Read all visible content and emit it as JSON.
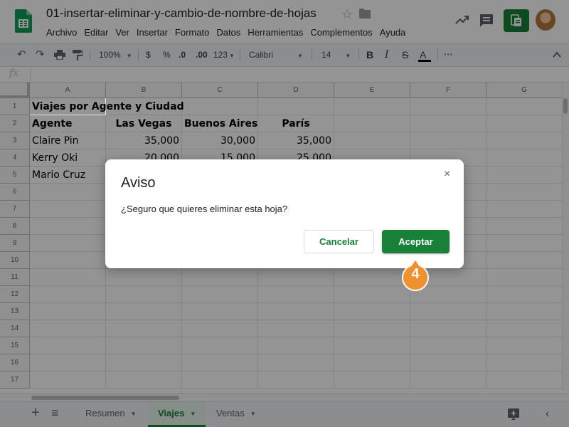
{
  "window": {
    "doc_title": "01-insertar-eliminar-y-cambio-de-nombre-de-hojas"
  },
  "menu": [
    "Archivo",
    "Editar",
    "Ver",
    "Insertar",
    "Formato",
    "Datos",
    "Herramientas",
    "Complementos",
    "Ayuda"
  ],
  "toolbar": {
    "zoom": "100%",
    "currency": "$",
    "percent": "%",
    "decrease_decimals": ".0",
    "increase_decimals": ".00",
    "more_formats": "123",
    "font": "Calibri",
    "font_size": "14",
    "bold": "B",
    "italic": "I",
    "strikethrough": "S",
    "text_color": "A",
    "more": "···"
  },
  "formula_bar": {
    "label": "fx",
    "value": ""
  },
  "grid": {
    "columns": [
      "A",
      "B",
      "C",
      "D",
      "E",
      "F",
      "G"
    ],
    "row_numbers": [
      "1",
      "2",
      "3",
      "4",
      "5",
      "6",
      "7",
      "8",
      "9",
      "10",
      "11",
      "12",
      "13",
      "14",
      "15",
      "16",
      "17"
    ],
    "rows": [
      [
        "Viajes por Agente y Ciudad",
        "",
        "",
        "",
        "",
        "",
        ""
      ],
      [
        "Agente",
        "Las Vegas",
        "Buenos Aires",
        "París",
        "",
        "",
        ""
      ],
      [
        "Claire Pin",
        "35,000",
        "30,000",
        "35,000",
        "",
        "",
        ""
      ],
      [
        "Kerry Oki",
        "20,000",
        "15,000",
        "25,000",
        "",
        "",
        ""
      ],
      [
        "Mario Cruz",
        "",
        "",
        "",
        "",
        "",
        ""
      ]
    ]
  },
  "sheet_tabs": {
    "add": "+",
    "list": "≡",
    "tabs": [
      {
        "label": "Resumen",
        "active": false
      },
      {
        "label": "Viajes",
        "active": true
      },
      {
        "label": "Ventas",
        "active": false
      }
    ]
  },
  "dialog": {
    "title": "Aviso",
    "message": "¿Seguro que quieres eliminar esta hoja?",
    "close": "×",
    "cancel_label": "Cancelar",
    "accept_label": "Aceptar"
  },
  "callout": {
    "step": "4"
  },
  "colors": {
    "brand_green": "#188038",
    "callout_orange": "#f0912f"
  }
}
